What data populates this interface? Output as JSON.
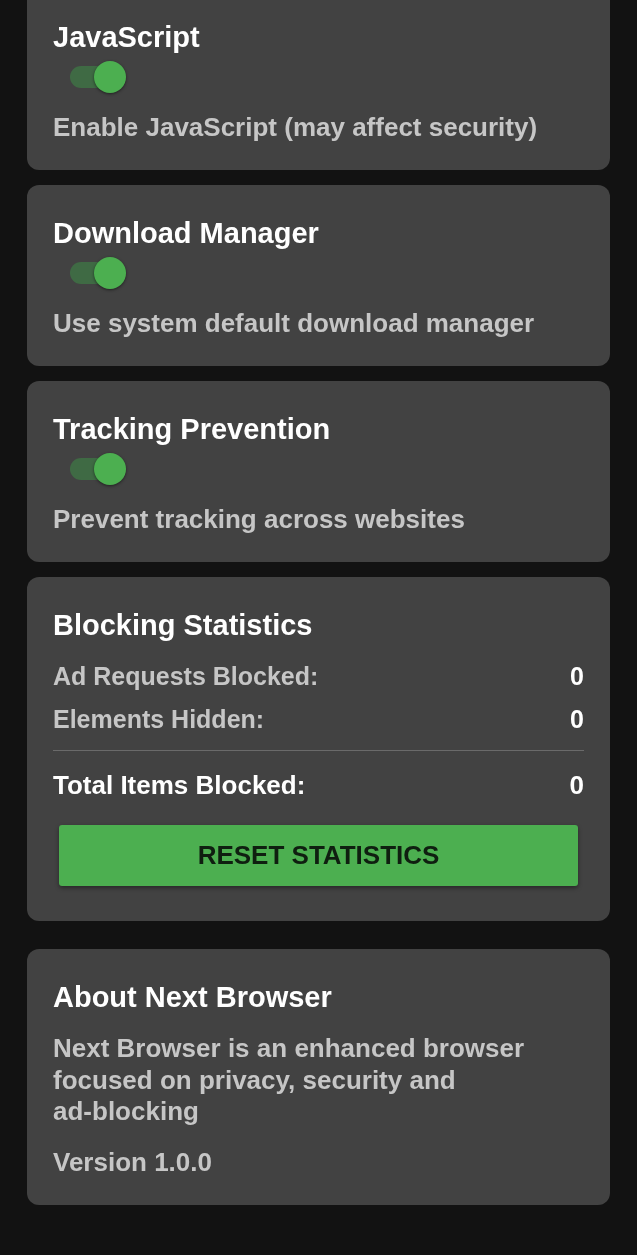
{
  "settings": [
    {
      "title": "JavaScript",
      "on": true,
      "description": "Enable JavaScript (may affect security)"
    },
    {
      "title": "Download Manager",
      "on": true,
      "description": "Use system default download manager"
    },
    {
      "title": "Tracking Prevention",
      "on": true,
      "description": "Prevent tracking across websites"
    }
  ],
  "statistics": {
    "title": "Blocking Statistics",
    "rows": [
      {
        "label": "Ad Requests Blocked:",
        "value": "0"
      },
      {
        "label": "Elements Hidden:",
        "value": "0"
      }
    ],
    "total": {
      "label": "Total Items Blocked:",
      "value": "0"
    },
    "button": "RESET STATISTICS"
  },
  "about": {
    "title": "About Next Browser",
    "description": "Next Browser is an enhanced browser focused on privacy, security and ad-blocking",
    "version": "Version 1.0.0"
  }
}
